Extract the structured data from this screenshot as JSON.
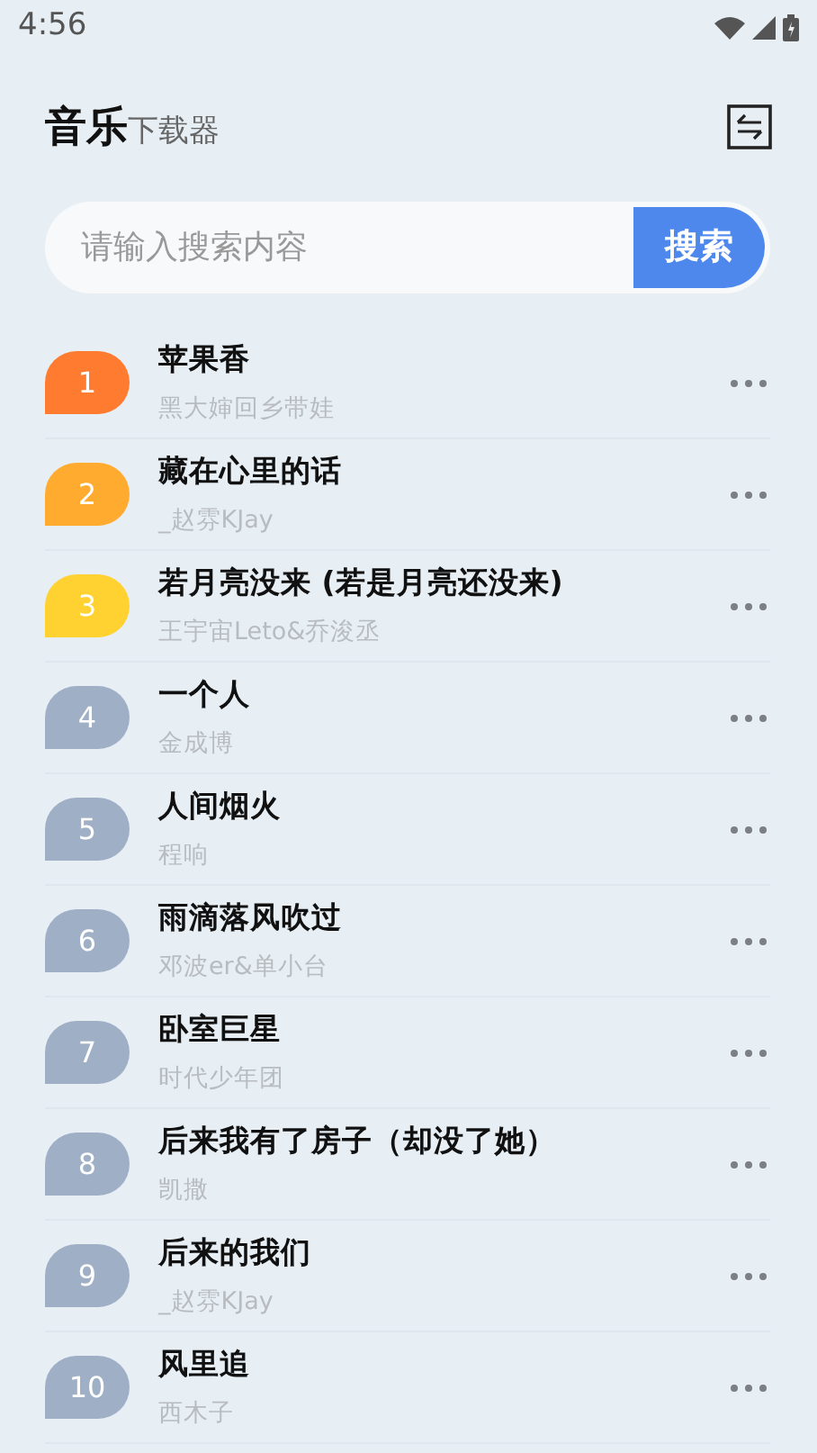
{
  "status_bar": {
    "time": "4:56"
  },
  "header": {
    "title": "音乐",
    "subtitle": "下载器"
  },
  "search": {
    "placeholder": "请输入搜索内容",
    "button": "搜索"
  },
  "songs": [
    {
      "rank": "1",
      "color": "#ff7b30",
      "title": "苹果香",
      "artist": "黑大婶回乡带娃"
    },
    {
      "rank": "2",
      "color": "#ffab30",
      "title": "藏在心里的话",
      "artist": "_赵雰KJay"
    },
    {
      "rank": "3",
      "color": "#ffd232",
      "title": "若月亮没来 (若是月亮还没来)",
      "artist": "王宇宙Leto&乔浚丞"
    },
    {
      "rank": "4",
      "color": "#9fb0c6",
      "title": "一个人",
      "artist": "金成博"
    },
    {
      "rank": "5",
      "color": "#9fb0c6",
      "title": "人间烟火",
      "artist": "程响"
    },
    {
      "rank": "6",
      "color": "#9fb0c6",
      "title": "雨滴落风吹过",
      "artist": "邓波er&单小台"
    },
    {
      "rank": "7",
      "color": "#9fb0c6",
      "title": "卧室巨星",
      "artist": "时代少年团"
    },
    {
      "rank": "8",
      "color": "#9fb0c6",
      "title": "后来我有了房子（却没了她）",
      "artist": "凯撒"
    },
    {
      "rank": "9",
      "color": "#9fb0c6",
      "title": "后来的我们",
      "artist": "_赵雰KJay"
    },
    {
      "rank": "10",
      "color": "#9fb0c6",
      "title": "风里追",
      "artist": "西木子"
    }
  ]
}
